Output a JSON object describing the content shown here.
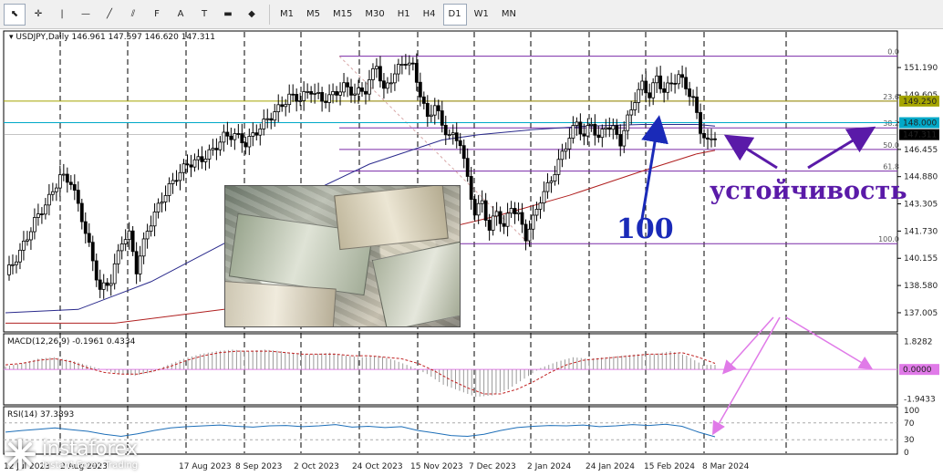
{
  "toolbar": {
    "icons": [
      "cursor-icon",
      "crosshair-icon",
      "vertical-line-icon",
      "horizontal-line-icon",
      "trendline-icon",
      "equidistant-channel-icon",
      "fibonacci-icon",
      "text-icon",
      "text-label-icon",
      "rectangle-icon",
      "shapes-dropdown-icon"
    ],
    "icon_glyphs": [
      "⬉",
      "✛",
      "|",
      "—",
      "╱",
      "⫽",
      "F",
      "A",
      "T",
      "▬",
      "◆"
    ],
    "timeframes": [
      "M1",
      "M5",
      "M15",
      "M30",
      "H1",
      "H4",
      "D1",
      "W1",
      "MN"
    ],
    "active_timeframe": "D1"
  },
  "chart_data": [
    {
      "type": "candlestick",
      "title": "USDJPY,Daily",
      "ohlc_header": "146.961 147.597 146.620 147.311",
      "symbol": "USDJPY",
      "timeframe": "Daily",
      "last_price": "147.311",
      "ylim": [
        136.0,
        153.2
      ],
      "y_ticks": [
        "151.190",
        "149.605",
        "148.020",
        "146.455",
        "144.880",
        "143.305",
        "141.730",
        "140.155",
        "138.580",
        "137.005"
      ],
      "x_ticks": [
        "12 Jul 2023",
        "2 Aug 2023",
        "17 Aug 2023",
        "8 Sep 2023",
        "2 Oct 2023",
        "24 Oct 2023",
        "15 Nov 2023",
        "7 Dec 2023",
        "2 Jan 2024",
        "24 Jan 2024",
        "15 Feb 2024",
        "8 Mar 2024"
      ],
      "price_path": [
        [
          0,
          139.2
        ],
        [
          4,
          140.5
        ],
        [
          8,
          142.3
        ],
        [
          12,
          143.6
        ],
        [
          15,
          144.9
        ],
        [
          18,
          144.6
        ],
        [
          21,
          142.5
        ],
        [
          24,
          140.0
        ],
        [
          26,
          138.3
        ],
        [
          29,
          138.9
        ],
        [
          32,
          141.2
        ],
        [
          34,
          141.5
        ],
        [
          36,
          139.5
        ],
        [
          39,
          141.8
        ],
        [
          43,
          143.6
        ],
        [
          47,
          144.9
        ],
        [
          50,
          145.6
        ],
        [
          54,
          145.9
        ],
        [
          57,
          146.4
        ],
        [
          60,
          147.2
        ],
        [
          63,
          147.3
        ],
        [
          66,
          146.8
        ],
        [
          69,
          147.5
        ],
        [
          72,
          148.2
        ],
        [
          75,
          148.8
        ],
        [
          78,
          149.5
        ],
        [
          81,
          149.4
        ],
        [
          84,
          149.9
        ],
        [
          87,
          149.3
        ],
        [
          90,
          149.6
        ],
        [
          93,
          150.1
        ],
        [
          96,
          149.7
        ],
        [
          99,
          149.9
        ],
        [
          102,
          151.4
        ],
        [
          104,
          149.8
        ],
        [
          107,
          150.9
        ],
        [
          110,
          151.6
        ],
        [
          112,
          151.2
        ],
        [
          114,
          149.7
        ],
        [
          116,
          148.2
        ],
        [
          118,
          149.1
        ],
        [
          120,
          147.8
        ],
        [
          122,
          147.3
        ],
        [
          125,
          146.9
        ],
        [
          127,
          144.7
        ],
        [
          129,
          142.8
        ],
        [
          131,
          143.4
        ],
        [
          133,
          141.8
        ],
        [
          135,
          142.9
        ],
        [
          137,
          141.9
        ],
        [
          139,
          143.2
        ],
        [
          141,
          142.6
        ],
        [
          143,
          141.4
        ],
        [
          145,
          142.4
        ],
        [
          147,
          143.6
        ],
        [
          149,
          144.3
        ],
        [
          151,
          145.2
        ],
        [
          153,
          146.2
        ],
        [
          155,
          147.2
        ],
        [
          157,
          148.0
        ],
        [
          159,
          147.2
        ],
        [
          161,
          148.0
        ],
        [
          163,
          147.0
        ],
        [
          165,
          147.9
        ],
        [
          167,
          147.6
        ],
        [
          169,
          146.9
        ],
        [
          171,
          148.2
        ],
        [
          173,
          149.4
        ],
        [
          175,
          150.2
        ],
        [
          177,
          149.6
        ],
        [
          179,
          150.6
        ],
        [
          181,
          149.8
        ],
        [
          183,
          150.3
        ],
        [
          185,
          150.7
        ],
        [
          187,
          150.1
        ],
        [
          189,
          149.3
        ],
        [
          191,
          147.6
        ],
        [
          193,
          146.8
        ],
        [
          195,
          147.3
        ]
      ],
      "ma100": [
        [
          0,
          137.0
        ],
        [
          20,
          137.2
        ],
        [
          40,
          138.8
        ],
        [
          60,
          141.0
        ],
        [
          80,
          143.6
        ],
        [
          100,
          145.6
        ],
        [
          120,
          147.0
        ],
        [
          130,
          147.3
        ],
        [
          145,
          147.6
        ],
        [
          160,
          147.8
        ],
        [
          175,
          147.9
        ],
        [
          190,
          147.9
        ],
        [
          195,
          147.8
        ]
      ],
      "ma200": [
        [
          0,
          136.4
        ],
        [
          30,
          136.4
        ],
        [
          60,
          137.2
        ],
        [
          90,
          139.2
        ],
        [
          115,
          141.6
        ],
        [
          135,
          142.6
        ],
        [
          155,
          143.8
        ],
        [
          175,
          145.2
        ],
        [
          190,
          146.2
        ],
        [
          195,
          146.4
        ]
      ],
      "fib_levels": [
        {
          "label": "0.0",
          "price": 151.85
        },
        {
          "label": "23.6",
          "price": 149.25
        },
        {
          "label": "38.2",
          "price": 147.7
        },
        {
          "label": "50.0",
          "price": 146.45
        },
        {
          "label": "61.8",
          "price": 145.2
        },
        {
          "label": "100.0",
          "price": 141.0
        }
      ],
      "horizontal_lines": [
        {
          "label": "149.250",
          "price": 149.25,
          "color": "#a4a400"
        },
        {
          "label": "148.000",
          "price": 148.0,
          "color": "#00a8c8"
        }
      ],
      "annotations": [
        "устойчивость",
        "100"
      ],
      "colors": {
        "candle": "#000000",
        "ma100": "#2a2a8c",
        "ma200": "#b02020",
        "fib": "#7a2aa8",
        "annotation": "#5a1aa8",
        "arrow_blue": "#1a2ab8",
        "arrow_pink": "#e07ae8"
      }
    },
    {
      "type": "histogram",
      "title": "MACD(12,26,9) -0.1961 0.4334",
      "ylim": [
        -2.2,
        2.1
      ],
      "y_ticks": [
        "1.8282",
        "0.0000",
        "-1.9433"
      ],
      "histogram": [
        0.2,
        0.4,
        0.7,
        0.8,
        0.6,
        0.3,
        0.0,
        -0.3,
        -0.4,
        -0.2,
        0.3,
        0.7,
        1.0,
        1.2,
        1.3,
        1.2,
        1.3,
        1.2,
        1.0,
        1.0,
        1.1,
        0.9,
        0.8,
        0.9,
        0.6,
        0.2,
        -0.3,
        -1.0,
        -1.4,
        -1.8,
        -1.7,
        -1.3,
        -0.6,
        0.1,
        0.5,
        0.8,
        0.7,
        0.8,
        0.9,
        1.0,
        1.0,
        1.2,
        0.9,
        0.3
      ],
      "signal": [
        0.3,
        0.4,
        0.6,
        0.7,
        0.5,
        0.1,
        -0.2,
        -0.3,
        -0.3,
        -0.1,
        0.2,
        0.6,
        0.9,
        1.1,
        1.2,
        1.2,
        1.2,
        1.1,
        1.0,
        1.0,
        1.0,
        0.9,
        0.9,
        0.8,
        0.7,
        0.4,
        -0.1,
        -0.7,
        -1.2,
        -1.6,
        -1.6,
        -1.3,
        -0.8,
        -0.2,
        0.3,
        0.6,
        0.7,
        0.8,
        0.9,
        1.0,
        1.0,
        1.1,
        0.8,
        0.4
      ],
      "zero_label": "0.0000"
    },
    {
      "type": "line",
      "title": "RSI(14) 37.3893",
      "ylim": [
        0,
        100
      ],
      "y_ticks": [
        "70",
        "30",
        "0"
      ],
      "level_labels": [
        "100",
        "70",
        "30",
        "0"
      ],
      "values": [
        48,
        52,
        55,
        58,
        54,
        50,
        43,
        38,
        44,
        52,
        58,
        61,
        63,
        65,
        62,
        60,
        63,
        64,
        61,
        63,
        66,
        60,
        62,
        59,
        61,
        52,
        46,
        40,
        38,
        43,
        52,
        59,
        62,
        64,
        63,
        65,
        61,
        63,
        66,
        64,
        67,
        62,
        48,
        37
      ]
    }
  ],
  "watermark": {
    "brand": "instaforex",
    "tagline": "Instant Forex Trading"
  }
}
